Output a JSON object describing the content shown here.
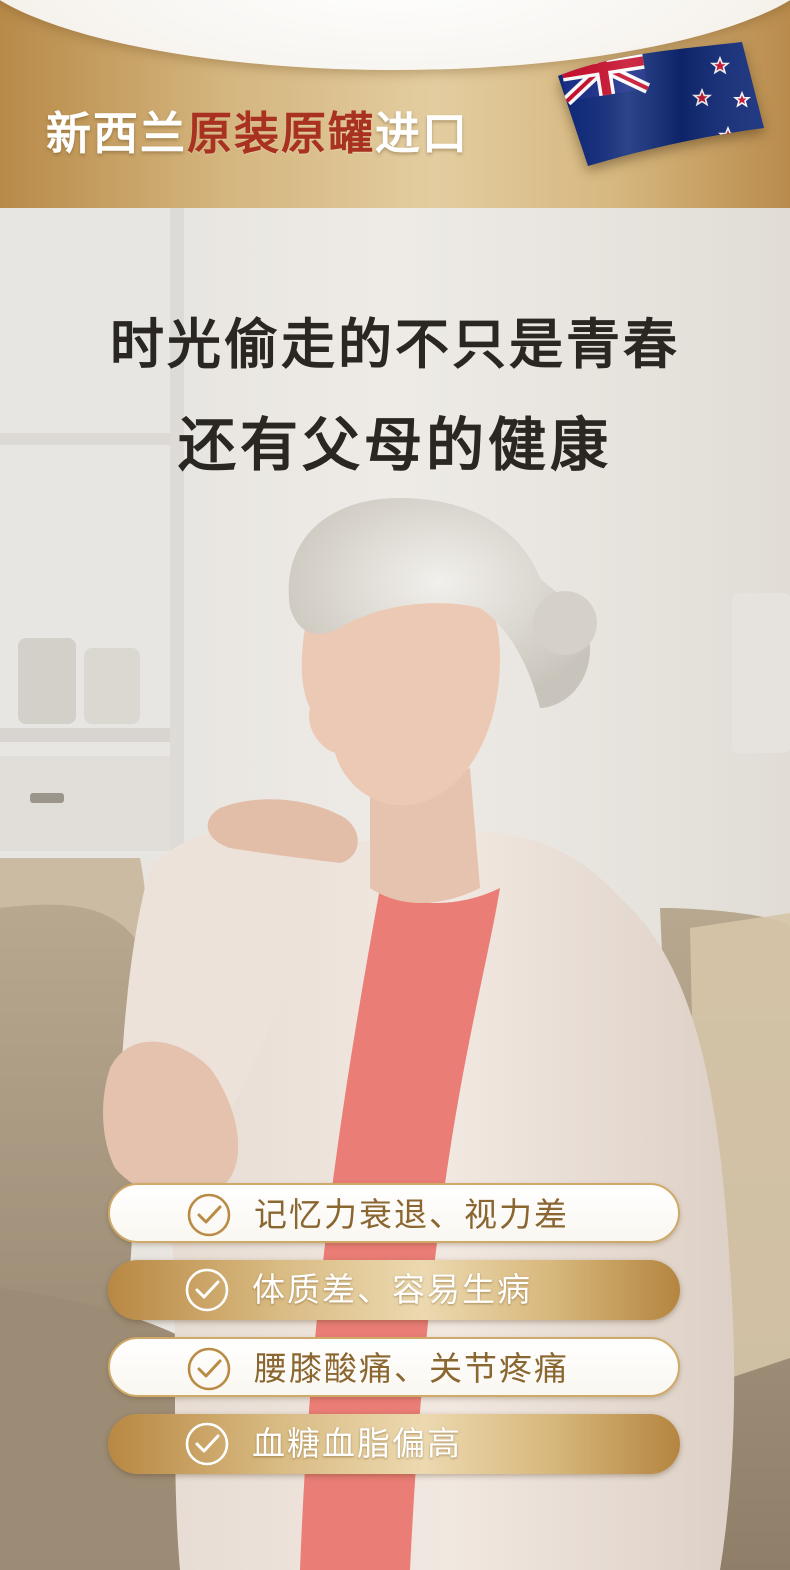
{
  "banner": {
    "title_part1": "新西兰",
    "title_part2": "原装原罐",
    "title_part3": "进口",
    "flag_icon": "new-zealand-flag-icon"
  },
  "headline": {
    "line1": "时光偷走的不只是青春",
    "line2": "还有父母的健康"
  },
  "symptoms": [
    {
      "label": "记忆力衰退、视力差",
      "style": "light"
    },
    {
      "label": "体质差、容易生病",
      "style": "gold"
    },
    {
      "label": "腰膝酸痛、关节疼痛",
      "style": "light"
    },
    {
      "label": "血糖血脂偏高",
      "style": "gold"
    }
  ],
  "colors": {
    "gold": "#cfa968",
    "gold_dark": "#b88843",
    "accent_red": "#a8321f",
    "text_dark": "#2a2622",
    "text_gold": "#8a6630"
  }
}
